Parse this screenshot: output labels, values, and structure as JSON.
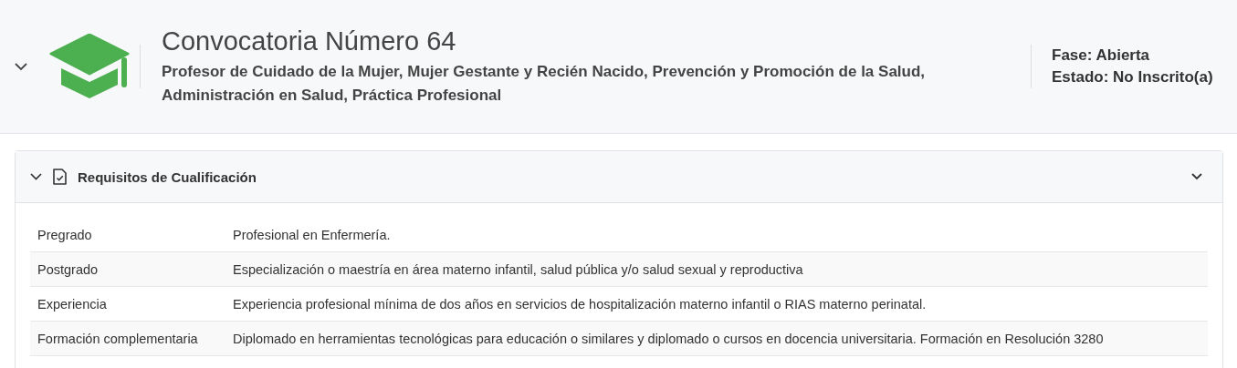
{
  "header": {
    "title": "Convocatoria Número 64",
    "subtitle": "Profesor de Cuidado de la Mujer, Mujer Gestante y Recién Nacido, Prevención y Promoción de la Salud, Administración en Salud, Práctica Profesional",
    "status": [
      "Fase: Abierta",
      "Estado: No Inscrito(a)"
    ]
  },
  "panel": {
    "title": "Requisitos de Cualificación",
    "expanded": true,
    "rows": [
      {
        "label": "Pregrado",
        "value": "Profesional en Enfermería."
      },
      {
        "label": "Postgrado",
        "value": "Especialización o maestría en área materno infantil, salud pública y/o salud sexual y reproductiva"
      },
      {
        "label": "Experiencia",
        "value": "Experiencia profesional mínima de dos años en servicios de hospitalización materno infantil o RIAS materno perinatal."
      },
      {
        "label": "Formación complementaria",
        "value": "Diplomado en herramientas tecnológicas para educación o similares y diplomado o cursos en docencia universitaria. Formación en Resolución 3280"
      }
    ]
  }
}
